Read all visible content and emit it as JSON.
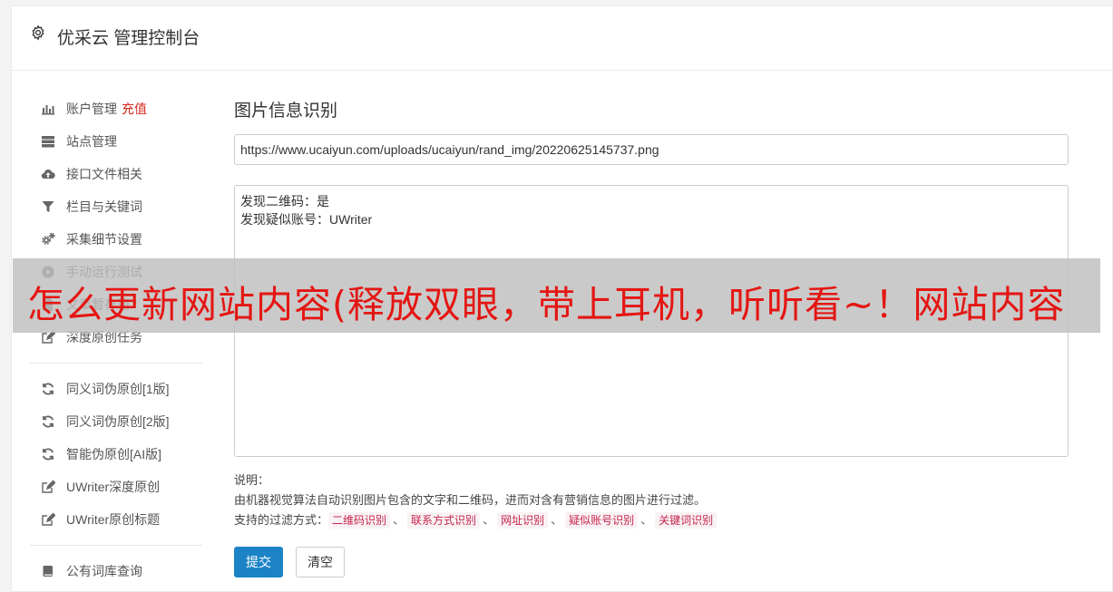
{
  "header": {
    "title": "优采云 管理控制台",
    "icon": "gear-icon"
  },
  "sidebar": {
    "groups": [
      [
        {
          "icon": "bar-chart-icon",
          "label": "账户管理",
          "extra": "充值"
        },
        {
          "icon": "server-icon",
          "label": "站点管理"
        },
        {
          "icon": "cloud-upload-icon",
          "label": "接口文件相关"
        },
        {
          "icon": "filter-icon",
          "label": "栏目与关键词"
        },
        {
          "icon": "cogs-icon",
          "label": "采集细节设置"
        },
        {
          "icon": "play-circle-icon",
          "label": "手动运行测试"
        },
        {
          "icon": "file-icon",
          "label": "文章暂存箱"
        },
        {
          "icon": "edit-icon",
          "label": "深度原创任务"
        }
      ],
      [
        {
          "icon": "refresh-icon",
          "label": "同义词伪原创[1版]"
        },
        {
          "icon": "refresh-icon",
          "label": "同义词伪原创[2版]"
        },
        {
          "icon": "refresh-icon",
          "label": "智能伪原创[AI版]"
        },
        {
          "icon": "edit-icon",
          "label": "UWriter深度原创"
        },
        {
          "icon": "edit-icon",
          "label": "UWriter原创标题"
        }
      ],
      [
        {
          "icon": "book-icon",
          "label": "公有词库查询"
        }
      ]
    ]
  },
  "main": {
    "title": "图片信息识别",
    "url_value": "https://www.ucaiyun.com/uploads/ucaiyun/rand_img/20220625145737.png",
    "result_lines": [
      "发现二维码：是",
      "发现疑似账号：UWriter"
    ],
    "notes": {
      "label": "说明：",
      "description": "由机器视觉算法自动识别图片包含的文字和二维码，进而对含有营销信息的图片进行过滤。",
      "methods_label": "支持的过滤方式：",
      "methods": [
        "二维码识别",
        "联系方式识别",
        "网址识别",
        "疑似账号识别",
        "关键词识别"
      ],
      "separator": "、"
    },
    "submit_label": "提交",
    "clear_label": "清空"
  },
  "overlay": {
    "text": "怎么更新网站内容(释放双眼，带上耳机，听听看~！网站内容"
  },
  "colors": {
    "accent": "#1c84c6",
    "recharge": "#d9251c",
    "tag_text": "#c7254e",
    "overlay_text": "#e41613"
  }
}
